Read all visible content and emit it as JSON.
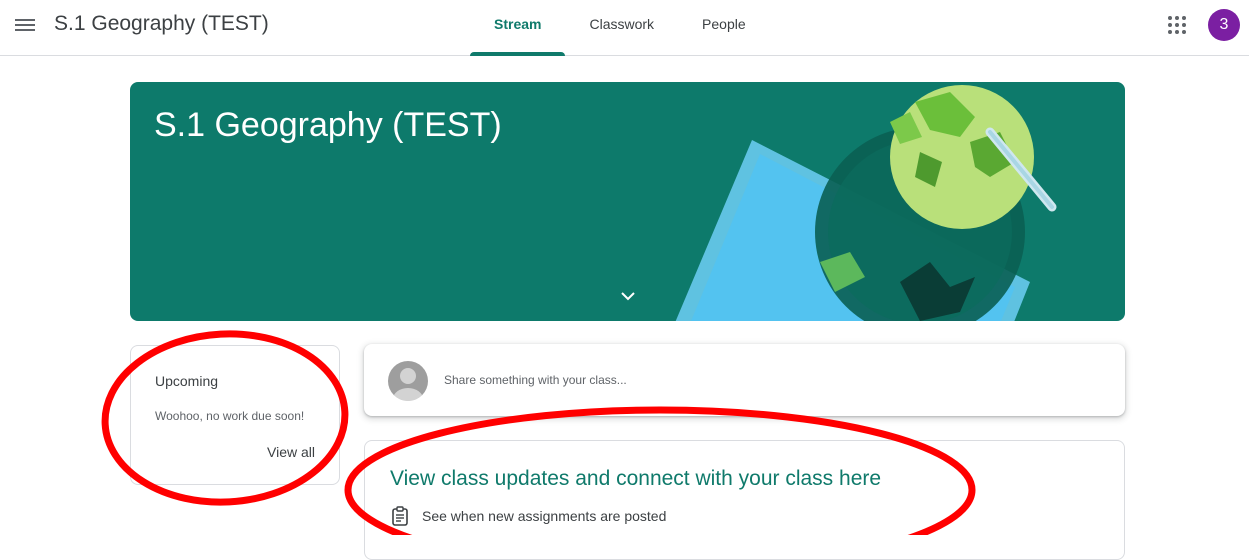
{
  "header": {
    "title": "S.1 Geography (TEST)",
    "tabs": [
      {
        "label": "Stream",
        "active": true
      },
      {
        "label": "Classwork",
        "active": false
      },
      {
        "label": "People",
        "active": false
      }
    ],
    "avatar_label": "3",
    "icons": {
      "menu": "hamburger-menu-icon",
      "apps": "apps-grid-icon"
    }
  },
  "banner": {
    "title": "S.1 Geography (TEST)",
    "color": "#0d7a6b",
    "expand_icon": "chevron-down-icon"
  },
  "upcoming": {
    "title": "Upcoming",
    "message": "Woohoo, no work due soon!",
    "view_all": "View all"
  },
  "share": {
    "placeholder": "Share something with your class..."
  },
  "updates": {
    "title": "View class updates and connect with your class here",
    "item": "See when new assignments are posted",
    "item_icon": "assignment-icon"
  },
  "colors": {
    "accent": "#0f7a6b",
    "avatar": "#7b1fa2",
    "annotation": "#ff0000"
  }
}
